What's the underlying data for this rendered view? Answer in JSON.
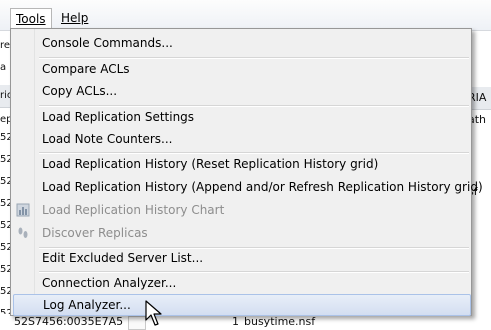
{
  "menubar": {
    "tools": "Tools",
    "help": "Help"
  },
  "background": {
    "left_rows": [
      "re",
      "a",
      "ric",
      "ep",
      "52",
      "52",
      "52",
      "52",
      "52",
      "52",
      "52",
      "52",
      "52"
    ],
    "right_cells": [
      "RIA",
      "ath",
      "sf"
    ],
    "bottom_row": {
      "id": "52S7456:0035E7A5",
      "col2": "1",
      "file": "busytime.nsf"
    }
  },
  "tools_menu": {
    "items": [
      {
        "label": "Console Commands...",
        "disabled": false
      },
      {
        "label": "Compare ACLs",
        "disabled": false
      },
      {
        "label": "Copy ACLs...",
        "disabled": false
      },
      {
        "label": "Load Replication Settings",
        "disabled": false
      },
      {
        "label": "Load Note Counters...",
        "disabled": false
      },
      {
        "label": "Load Replication History (Reset Replication History grid)",
        "disabled": false
      },
      {
        "label": "Load Replication History (Append and/or Refresh Replication History grid)",
        "disabled": false
      },
      {
        "label": "Load Replication History Chart",
        "disabled": true,
        "icon": "chart-icon"
      },
      {
        "label": "Discover Replicas",
        "disabled": true,
        "icon": "footprints-icon"
      },
      {
        "label": "Edit Excluded Server List...",
        "disabled": false
      },
      {
        "label": "Connection Analyzer...",
        "disabled": false
      },
      {
        "label": "Log Analyzer...",
        "disabled": false,
        "highlighted": true
      }
    ]
  },
  "colors": {
    "highlight_bg": "#d3def1",
    "highlight_border": "#aac2e8",
    "disabled_text": "#8d8d8d"
  }
}
